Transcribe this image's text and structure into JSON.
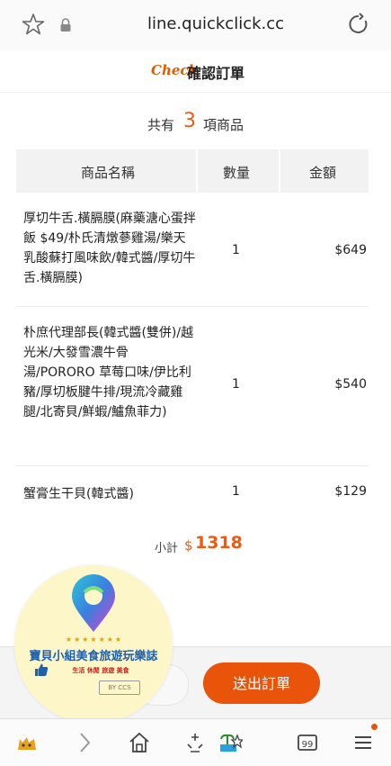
{
  "browser": {
    "url": "line.quickclick.cc"
  },
  "header": {
    "check_label": "Check",
    "title": "確認訂單"
  },
  "summary": {
    "prefix": "共有",
    "count": "3",
    "suffix": "項商品"
  },
  "table": {
    "headers": [
      "商品名稱",
      "數量",
      "金額"
    ],
    "rows": [
      {
        "name": "厚切牛舌.橫膈膜(麻藥溏心蛋拌飯 $49/朴氏清燉蔘雞湯/樂天 乳酸蘇打風味飲/韓式醬/厚切牛舌.橫膈膜)",
        "qty": "1",
        "amount": "$649"
      },
      {
        "name": "朴庶代理部長(韓式醬(雙併)/越光米/大發雪濃牛骨湯/PORORO 草莓口味/伊比利豬/厚切板腱牛排/現流冷藏雞腿/北寄貝/鮮蝦/鱸魚菲力)",
        "qty": "1",
        "amount": "$540"
      },
      {
        "name": "蟹膏生干貝(韓式醬)",
        "qty": "1",
        "amount": "$129"
      }
    ]
  },
  "subtotal": {
    "label": "小計",
    "currency": "$",
    "value": "1318"
  },
  "actions": {
    "submit_label": "送出訂單"
  },
  "watermark": {
    "stars": "★★★★★★★",
    "name": "寶貝小組美食旅遊玩樂誌",
    "tags": "生活 休閒 旅遊 美食",
    "by": "BY CCS"
  },
  "colors": {
    "accent": "#e9540a",
    "brand_blue": "#1d5fb0"
  }
}
